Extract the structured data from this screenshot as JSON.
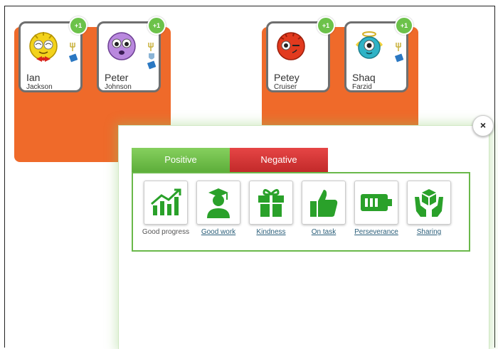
{
  "students": [
    {
      "first": "Ian",
      "last": "Jackson",
      "points": "+1"
    },
    {
      "first": "Peter",
      "last": "Johnson",
      "points": "+1"
    },
    {
      "first": "Petey",
      "last": "Cruiser",
      "points": "+1"
    },
    {
      "first": "Shaq",
      "last": "Farzid",
      "points": "+1"
    }
  ],
  "modal": {
    "close_label": "×",
    "tabs": {
      "positive": "Positive",
      "negative": "Negative"
    },
    "skills": [
      {
        "label": "Good progress"
      },
      {
        "label": "Good work"
      },
      {
        "label": "Kindness"
      },
      {
        "label": "On task"
      },
      {
        "label": "Perseverance"
      },
      {
        "label": "Sharing"
      }
    ]
  },
  "colors": {
    "accent_green": "#2aa12a",
    "group_orange": "#ef6a2a",
    "negative_red": "#d33"
  }
}
